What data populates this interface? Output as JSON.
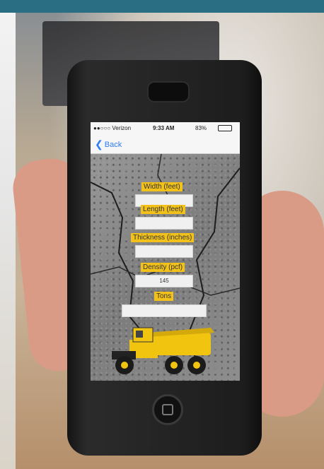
{
  "status_bar": {
    "carrier": "●●○○○ Verizon",
    "time": "9:33 AM",
    "battery": "83%"
  },
  "nav": {
    "back_label": "Back"
  },
  "form": {
    "width_label": "Width (feet)",
    "width_value": "",
    "length_label": "Length (feet)",
    "length_value": "",
    "thickness_label": "Thickness (inches)",
    "thickness_value": "",
    "density_label": "Density (pcf)",
    "density_value": "145",
    "tons_label": "Tons",
    "tons_value": ""
  },
  "colors": {
    "label_bg": "#f2c21b",
    "ios_blue": "#2f7cf6",
    "truck_yellow": "#f1c40f"
  },
  "icons": [
    "back-chevron-icon",
    "wifi-icon",
    "battery-icon",
    "home-button-icon"
  ]
}
